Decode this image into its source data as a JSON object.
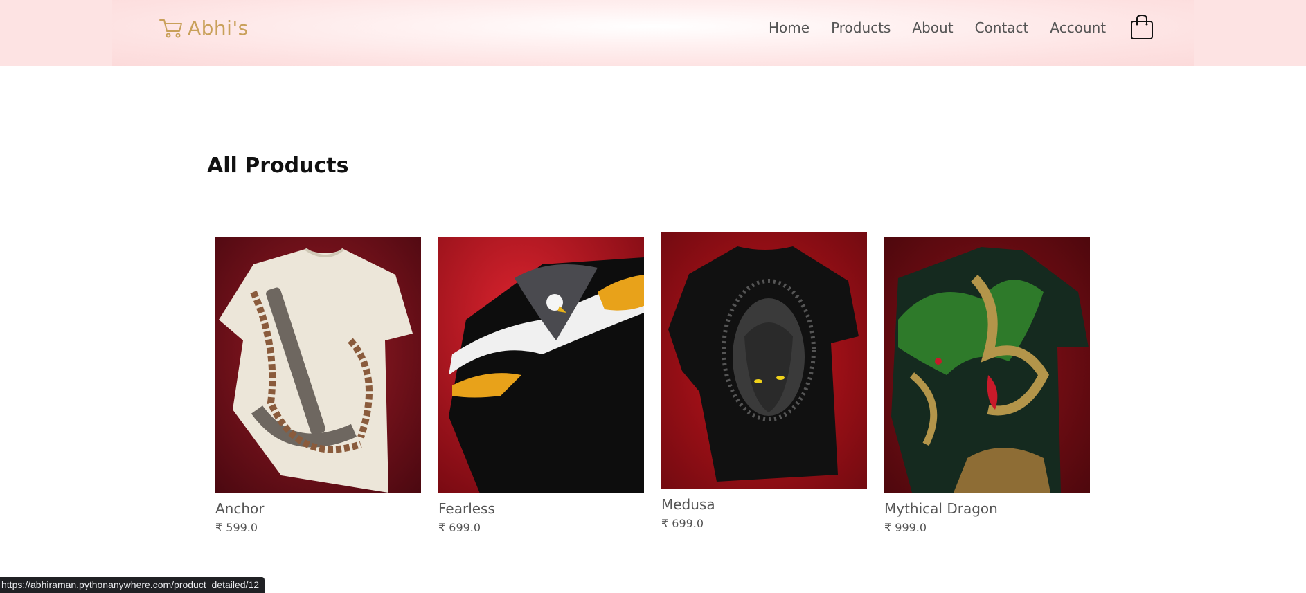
{
  "header": {
    "logo_text": "Abhi's",
    "logo_icon": "shopping-cart-icon",
    "nav": [
      "Home",
      "Products",
      "About",
      "Contact",
      "Account"
    ],
    "bag_icon": "shopping-bag-icon"
  },
  "main": {
    "title": "All Products",
    "products": [
      {
        "name": "Anchor",
        "price": "₹ 599.0",
        "image": "tshirt-anchor-print"
      },
      {
        "name": "Fearless",
        "price": "₹ 699.0",
        "image": "tshirt-eagle-print"
      },
      {
        "name": "Medusa",
        "price": "₹ 699.0",
        "image": "tshirt-medusa-print"
      },
      {
        "name": "Mythical Dragon",
        "price": "₹ 999.0",
        "image": "tshirt-dragon-print"
      }
    ]
  },
  "status_bar": {
    "url": "https://abhiraman.pythonanywhere.com/product_detailed/12"
  },
  "colors": {
    "header_bg": "#fde3e3",
    "logo_gold": "#c9a05a",
    "product_bg_red": "#b3121b",
    "status_bar_bg": "#202124"
  }
}
